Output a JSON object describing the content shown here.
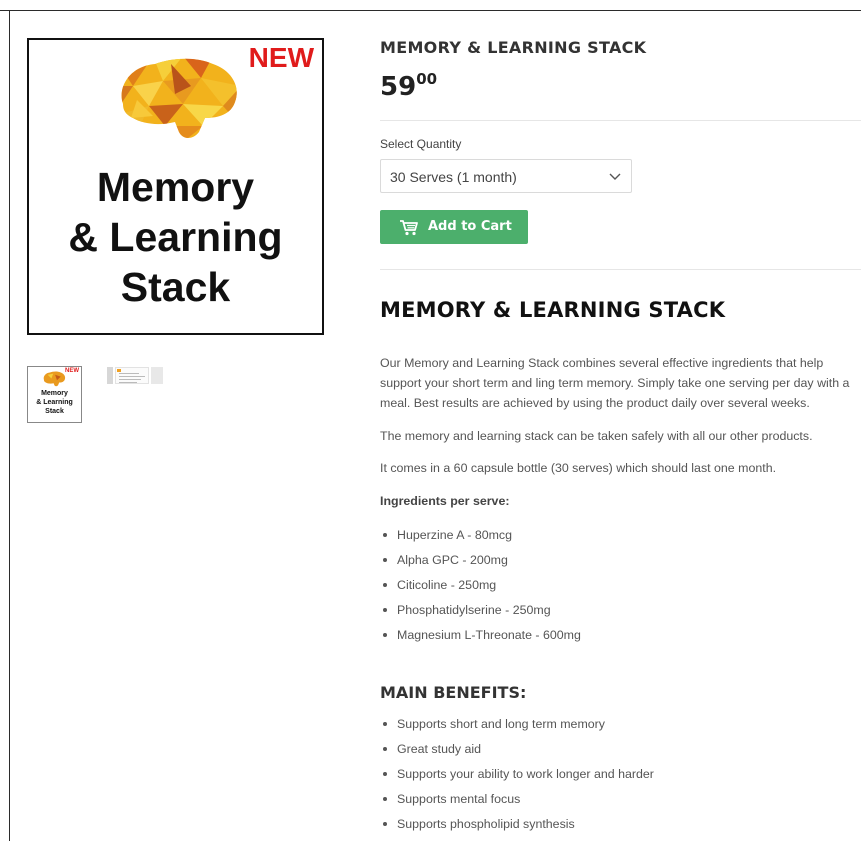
{
  "product": {
    "image": {
      "badge": "NEW",
      "title_lines": [
        "Memory",
        "& Learning",
        "Stack"
      ]
    },
    "thumbnail": {
      "badge": "NEW",
      "title_lines": [
        "Memory",
        "& Learning",
        "Stack"
      ]
    },
    "title": "MEMORY & LEARNING STACK",
    "price": {
      "main": "59",
      "cents": "00"
    },
    "quantity": {
      "label": "Select Quantity",
      "selected": "30 Serves (1 month)"
    },
    "add_to_cart_label": "Add to Cart"
  },
  "description": {
    "heading": "MEMORY & LEARNING STACK",
    "para1_lines": [
      "Our Memory and Learning Stack combines several effective ingredients that help",
      "support your short term and ling term memory. Simply take one serving per day with a",
      "meal. Best results are achieved by using the product daily over several weeks."
    ],
    "para2": "The memory and learning stack can be taken safely with all our other products.",
    "para3": "It comes in a 60 capsule bottle (30 serves) which should last one month.",
    "ingredients_heading": "Ingredients per serve:",
    "ingredients": [
      "Huperzine A - 80mcg",
      "Alpha GPC - 200mg",
      "Citicoline - 250mg",
      "Phosphatidylserine - 250mg",
      "Magnesium L-Threonate - 600mg"
    ],
    "benefits_heading": "MAIN BENEFITS:",
    "benefits": [
      "Supports short and long term memory",
      "Great study aid",
      "Supports your ability to work longer and harder",
      "Supports mental focus",
      "Supports phospholipid synthesis"
    ]
  },
  "colors": {
    "button_green": "#4caf6c",
    "badge_red": "#e01b1b"
  },
  "icons": [
    "brain-icon",
    "cart-icon",
    "chevron-down-icon"
  ]
}
